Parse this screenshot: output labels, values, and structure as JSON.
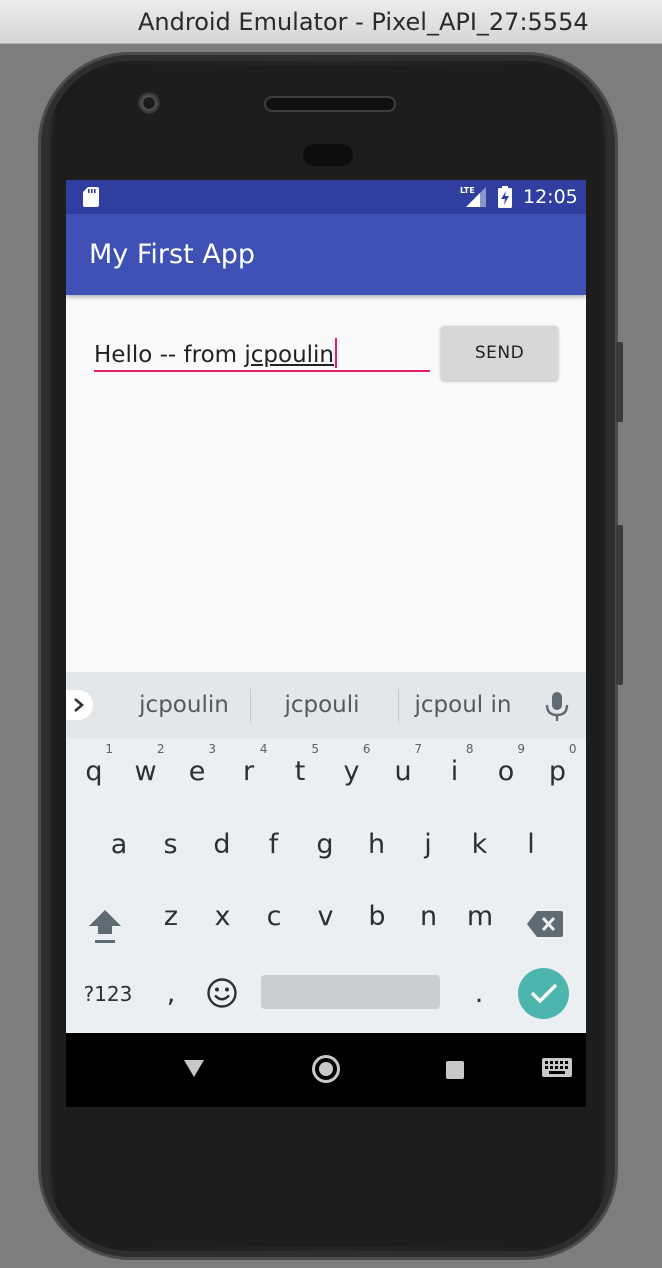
{
  "window": {
    "title": "Android Emulator - Pixel_API_27:5554"
  },
  "status_bar": {
    "time": "12:05",
    "network": "LTE",
    "icons": [
      "sd-card-icon",
      "lte-signal-icon",
      "battery-charging-icon"
    ]
  },
  "app_bar": {
    "title": "My First App",
    "color": "#3f51b5"
  },
  "message_input": {
    "prefix": "Hello -- from ",
    "composing": "jcpoulin",
    "accent": "#e91e63"
  },
  "send_button": {
    "label": "SEND"
  },
  "keyboard": {
    "suggestions": [
      "jcpoulin",
      "jcpouli",
      "jcpoul in"
    ],
    "row1": [
      {
        "k": "q",
        "n": "1"
      },
      {
        "k": "w",
        "n": "2"
      },
      {
        "k": "e",
        "n": "3"
      },
      {
        "k": "r",
        "n": "4"
      },
      {
        "k": "t",
        "n": "5"
      },
      {
        "k": "y",
        "n": "6"
      },
      {
        "k": "u",
        "n": "7"
      },
      {
        "k": "i",
        "n": "8"
      },
      {
        "k": "o",
        "n": "9"
      },
      {
        "k": "p",
        "n": "0"
      }
    ],
    "row2": [
      "a",
      "s",
      "d",
      "f",
      "g",
      "h",
      "j",
      "k",
      "l"
    ],
    "row3": [
      "z",
      "x",
      "c",
      "v",
      "b",
      "n",
      "m"
    ],
    "row4": {
      "symbols": "?123",
      "comma": ",",
      "period": "."
    },
    "enter_color": "#4db6ac"
  },
  "nav_bar": {
    "icons": [
      "back-icon",
      "home-icon",
      "recents-icon",
      "keyboard-switch-icon"
    ]
  }
}
